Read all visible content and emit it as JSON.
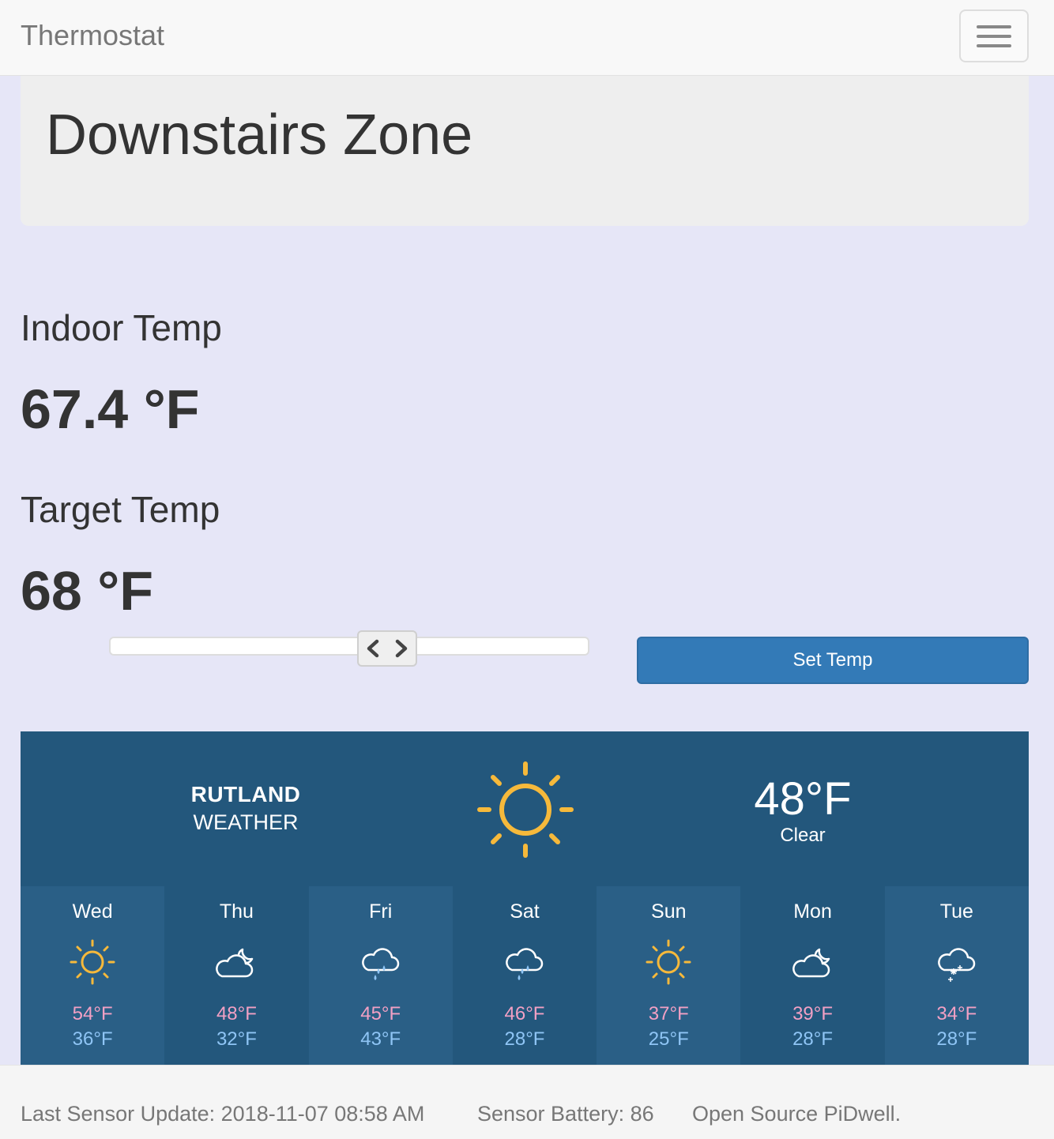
{
  "navbar": {
    "brand": "Thermostat",
    "menu_icon": "hamburger-icon"
  },
  "zone": {
    "title": "Downstairs Zone"
  },
  "indoor": {
    "label": "Indoor Temp",
    "value": "67.4 °F"
  },
  "target": {
    "label": "Target Temp",
    "value": "68 °F",
    "slider_fraction": 0.59
  },
  "set_button": {
    "label": "Set Temp",
    "color": "#337ab7"
  },
  "weather": {
    "city": "RUTLAND",
    "subtitle": "WEATHER",
    "current_temp": "48°F",
    "current_condition": "Clear",
    "current_icon": "sun-icon",
    "colors": {
      "background": "#23577c",
      "high": "#f2a0c4",
      "low": "#8fc5f5",
      "sun": "#f6b93b"
    },
    "forecast": [
      {
        "day": "Wed",
        "icon": "sun-icon",
        "high": "54°F",
        "low": "36°F"
      },
      {
        "day": "Thu",
        "icon": "cloud-moon-icon",
        "high": "48°F",
        "low": "32°F"
      },
      {
        "day": "Fri",
        "icon": "rain-cloud-icon",
        "high": "45°F",
        "low": "43°F"
      },
      {
        "day": "Sat",
        "icon": "rain-cloud-icon",
        "high": "46°F",
        "low": "28°F"
      },
      {
        "day": "Sun",
        "icon": "sun-icon",
        "high": "37°F",
        "low": "25°F"
      },
      {
        "day": "Mon",
        "icon": "cloud-moon-icon",
        "high": "39°F",
        "low": "28°F"
      },
      {
        "day": "Tue",
        "icon": "snow-cloud-icon",
        "high": "34°F",
        "low": "28°F"
      }
    ]
  },
  "footer": {
    "last_update": "Last Sensor Update: 2018-11-07 08:58 AM",
    "battery": "Sensor Battery: 86",
    "credit": "Open Source PiDwell."
  }
}
